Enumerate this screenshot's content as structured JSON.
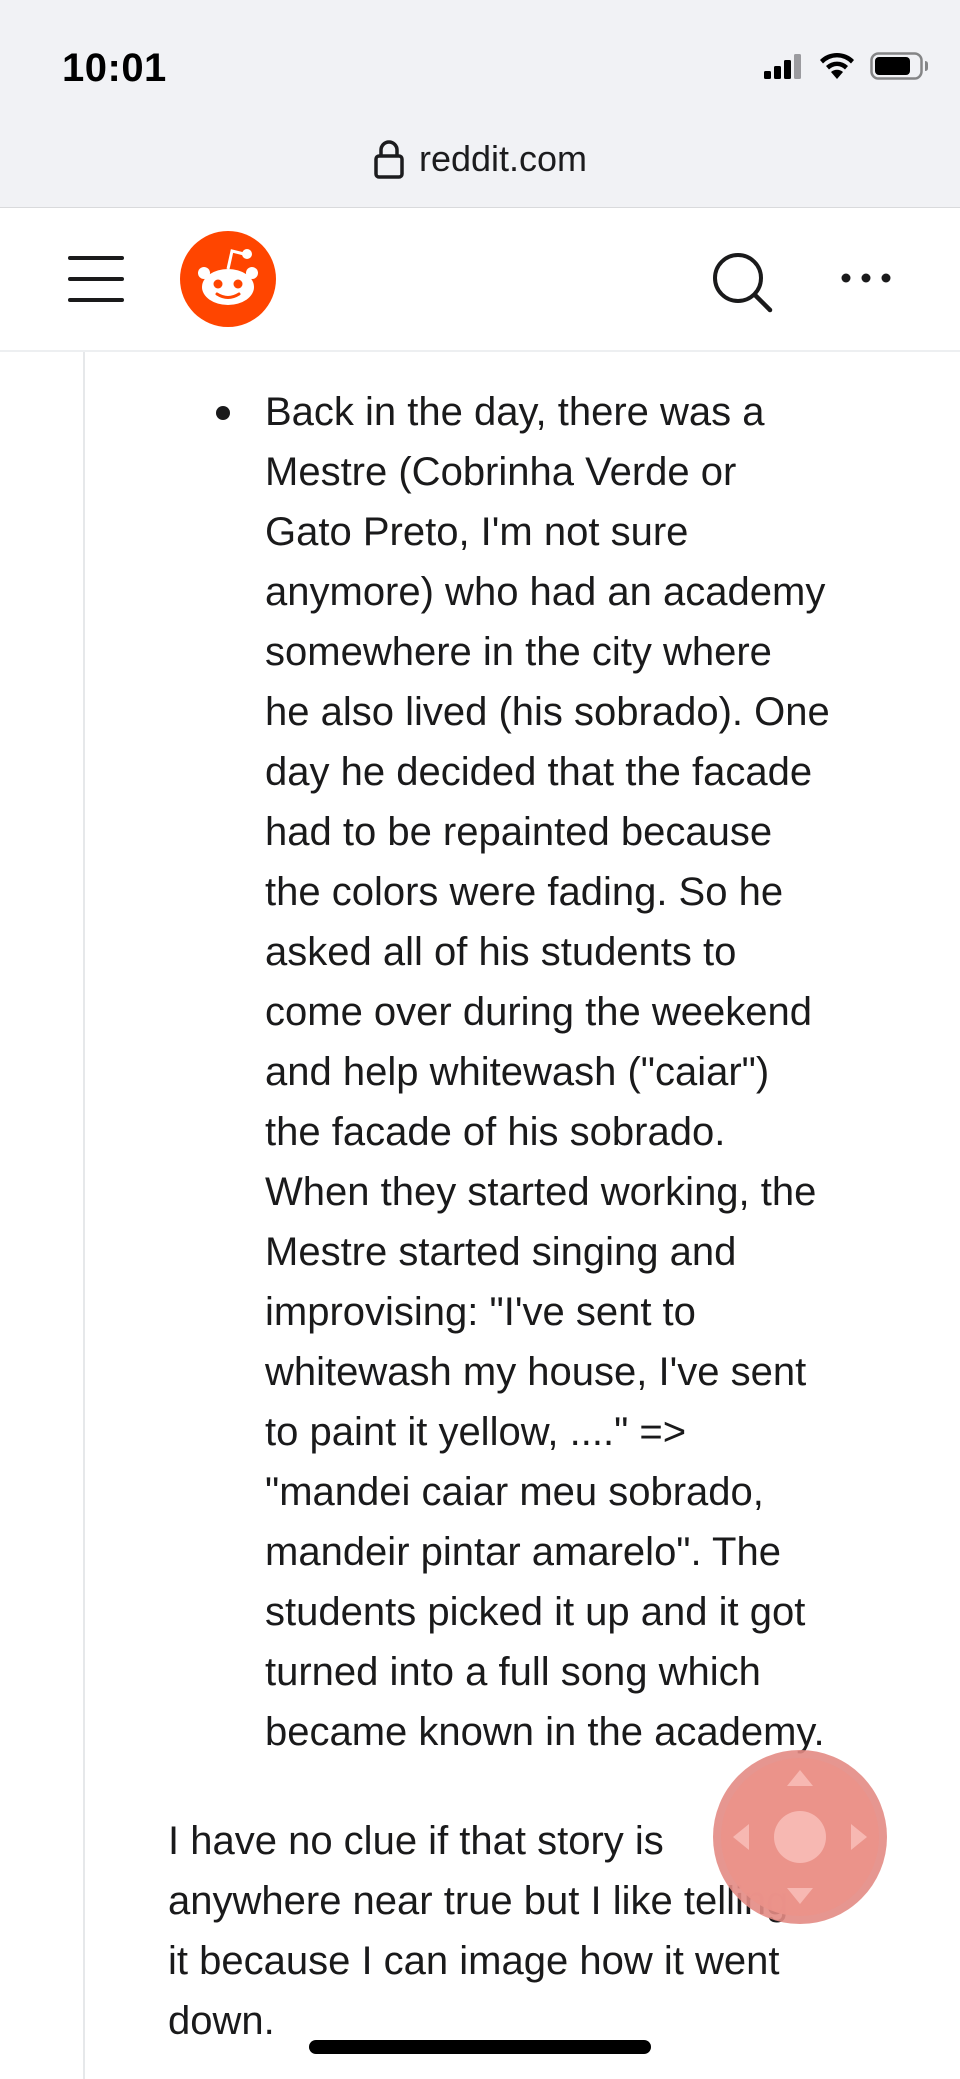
{
  "status_bar": {
    "time": "10:01",
    "icons": [
      "cellular-signal-icon",
      "wifi-icon",
      "battery-icon"
    ]
  },
  "url_bar": {
    "icon": "lock-icon",
    "domain": "reddit.com"
  },
  "header": {
    "menu_icon": "hamburger-menu-icon",
    "logo": "reddit-logo",
    "search_icon": "search-icon",
    "more_icon": "more-options-icon",
    "brand_color": "#ff4500"
  },
  "comment": {
    "bullet_lines": [
      "Back in the day, there was a",
      "Mestre (Cobrinha Verde or",
      "Gato Preto, I'm not sure",
      "anymore) who had an academy",
      "somewhere in the city where",
      "he also lived (his sobrado). One",
      "day he decided that the facade",
      "had to be repainted because",
      "the colors were fading. So he",
      "asked all of his students to",
      "come over during the weekend",
      "and help whitewash (\"caiar\")",
      "the facade of his sobrado.",
      "When they started working, the",
      "Mestre started singing and",
      "improvising: \"I've sent to",
      "whitewash my house, I've sent",
      "to paint it yellow, ....\" =>",
      "\"mandei caiar meu sobrado,",
      "mandeir pintar amarelo\". The",
      "students picked it up and it got",
      "turned into a full song which",
      "became known in the academy."
    ],
    "paragraph_lines": [
      "I have no clue if that story is",
      "anywhere near true but I like telling",
      "it because I can image how it went",
      "down."
    ]
  },
  "overlay": {
    "assistive_touch_icon": "assistive-touch-icon",
    "assistive_touch_color": "#f08a80"
  }
}
